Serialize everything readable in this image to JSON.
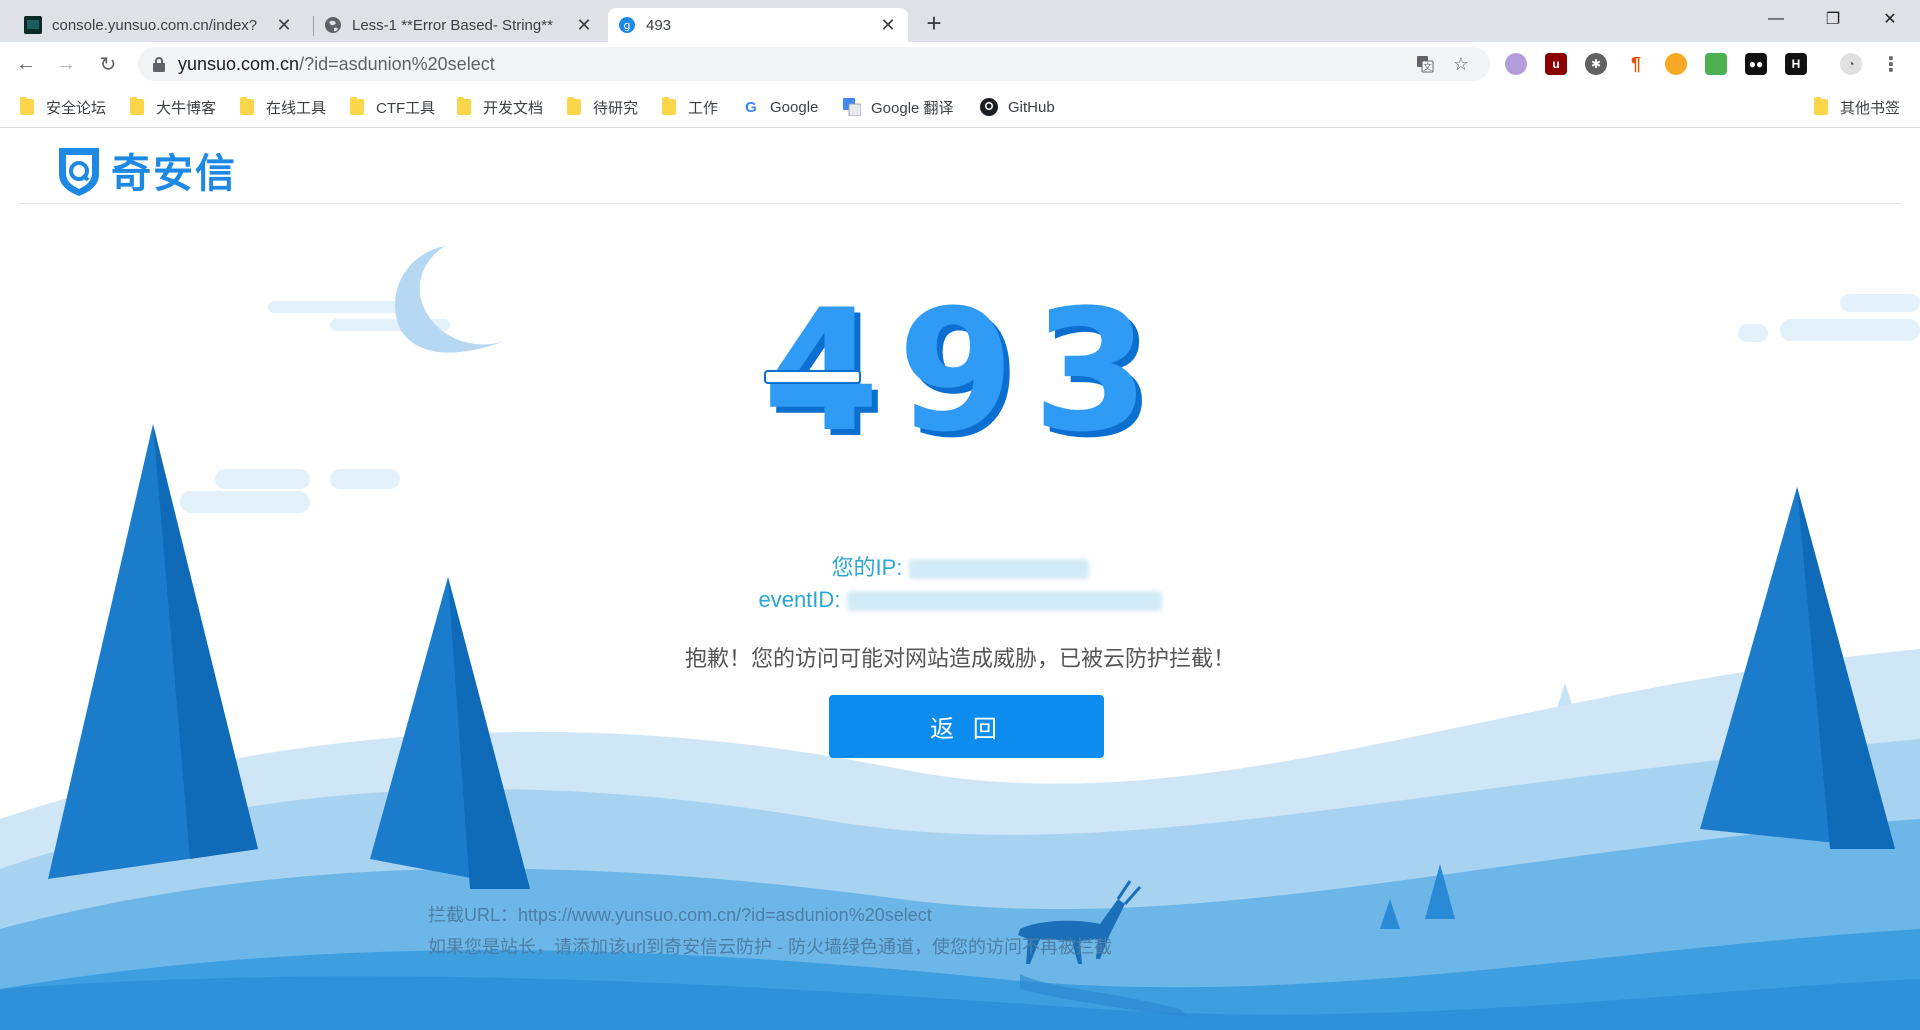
{
  "browser": {
    "tabs": [
      {
        "title": "console.yunsuo.com.cn/index?",
        "active": false
      },
      {
        "title": "Less-1 **Error Based- String**",
        "active": false
      },
      {
        "title": "493",
        "active": true
      }
    ],
    "url_host": "yunsuo.com.cn",
    "url_path": "/?id=asdunion%20select",
    "bookmarks": [
      "安全论坛",
      "大牛博客",
      "在线工具",
      "CTF工具",
      "开发文档",
      "待研究",
      "工作",
      "Google",
      "Google 翻译",
      "GitHub"
    ],
    "other_bookmarks": "其他书签"
  },
  "page": {
    "logo_text": "奇安信",
    "error_code": "493",
    "ip_label": "您的IP:",
    "event_label": "eventID:",
    "message": "抱歉！您的访问可能对网站造成威胁，已被云防护拦截！",
    "back_button": "返 回",
    "intercept_url": "拦截URL：https://www.yunsuo.com.cn/?id=asdunion%20select",
    "hint": "如果您是站长，请添加该url到奇安信云防护 - 防火墙绿色通道，使您的访问不再被拦截"
  },
  "colors": {
    "accent": "#0d8cf0",
    "code_blue": "#1e88e5",
    "info_text": "#2aa6d8"
  }
}
